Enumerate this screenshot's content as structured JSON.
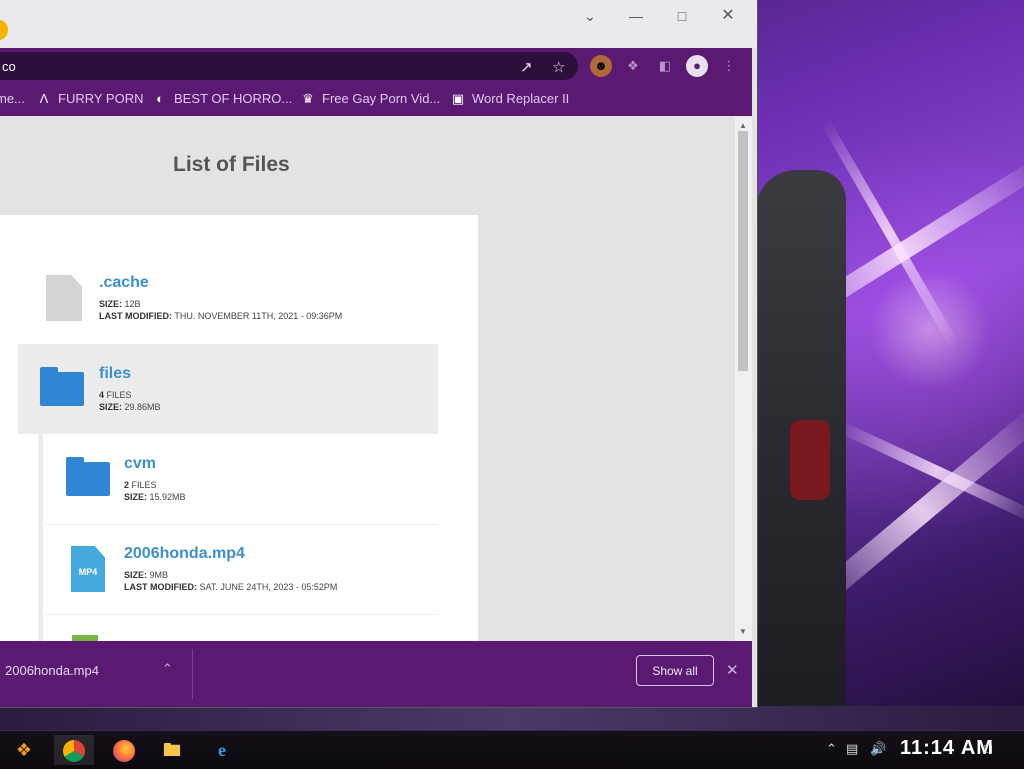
{
  "browser": {
    "omnibox_text": "co",
    "window_controls": [
      "chevron-down",
      "minimize",
      "maximize",
      "close"
    ],
    "bookmarks": [
      {
        "label": "me...",
        "icon": "page-icon"
      },
      {
        "label": "FURRY PORN",
        "icon": "a-logo-icon"
      },
      {
        "label": "BEST OF HORRO...",
        "icon": "globe-icon"
      },
      {
        "label": "Free Gay Porn Vid...",
        "icon": "site-icon"
      },
      {
        "label": "Word Replacer II",
        "icon": "wr-icon"
      }
    ]
  },
  "page": {
    "title": "List of Files",
    "entries": [
      {
        "name": ".cache",
        "type": "file",
        "size_label": "SIZE:",
        "size": "12B",
        "modified_label": "LAST MODIFIED:",
        "modified": "THU. NOVEMBER 11TH, 2021 - 09:36PM"
      },
      {
        "name": "files",
        "type": "folder",
        "count": "4",
        "count_label": "FILES",
        "size_label": "SIZE:",
        "size": "29.86MB"
      },
      {
        "name": "cvm",
        "type": "folder",
        "count": "2",
        "count_label": "FILES",
        "size_label": "SIZE:",
        "size": "15.92MB"
      },
      {
        "name": "2006honda.mp4",
        "type": "mp4",
        "icon_label": "MP4",
        "size_label": "SIZE:",
        "size": "9MB",
        "modified_label": "LAST MODIFIED:",
        "modified": "SAT. JUNE 24TH, 2023 - 05:52PM"
      }
    ]
  },
  "download_bar": {
    "filename": "2006honda.mp4",
    "show_all": "Show all"
  },
  "taskbar": {
    "apps": [
      "start-icon",
      "chrome-icon",
      "firefox-icon",
      "file-explorer-icon",
      "internet-explorer-icon"
    ],
    "clock": "11:14 AM"
  },
  "colors": {
    "chrome_accent": "#5a1a72",
    "link_blue": "#3d8fce",
    "folder_blue": "#2f87d3"
  }
}
